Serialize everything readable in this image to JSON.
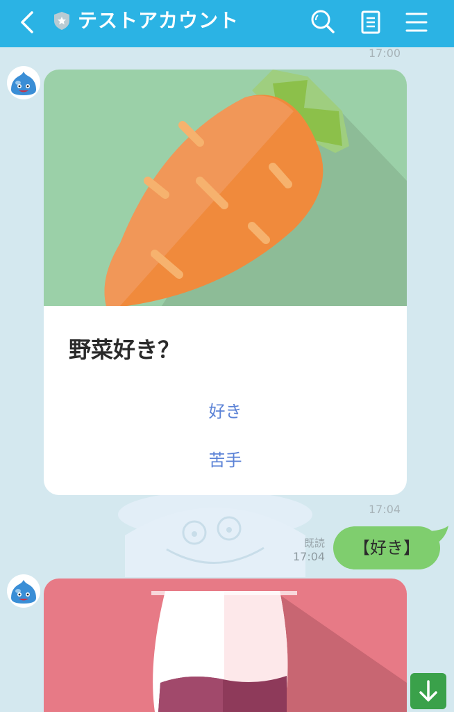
{
  "header": {
    "title": "テストアカウント"
  },
  "messages": {
    "time_top": "17:00",
    "card1": {
      "title": "野菜好き？",
      "actions": [
        "好き",
        "苦手"
      ],
      "time": "17:04"
    },
    "sent": {
      "read_label": "既読",
      "time": "17:04",
      "text": "【好き】"
    }
  },
  "colors": {
    "header_bg": "#2bb3e4",
    "chat_bg": "#d4e8ef",
    "bubble": "#7fce6e",
    "action_link": "#5b82d6",
    "scroll_button": "#3aa14a"
  },
  "icons": [
    "back-chevron-icon",
    "shield-star-icon",
    "search-icon",
    "note-icon",
    "menu-icon",
    "slime-avatar",
    "arrow-down-icon"
  ]
}
